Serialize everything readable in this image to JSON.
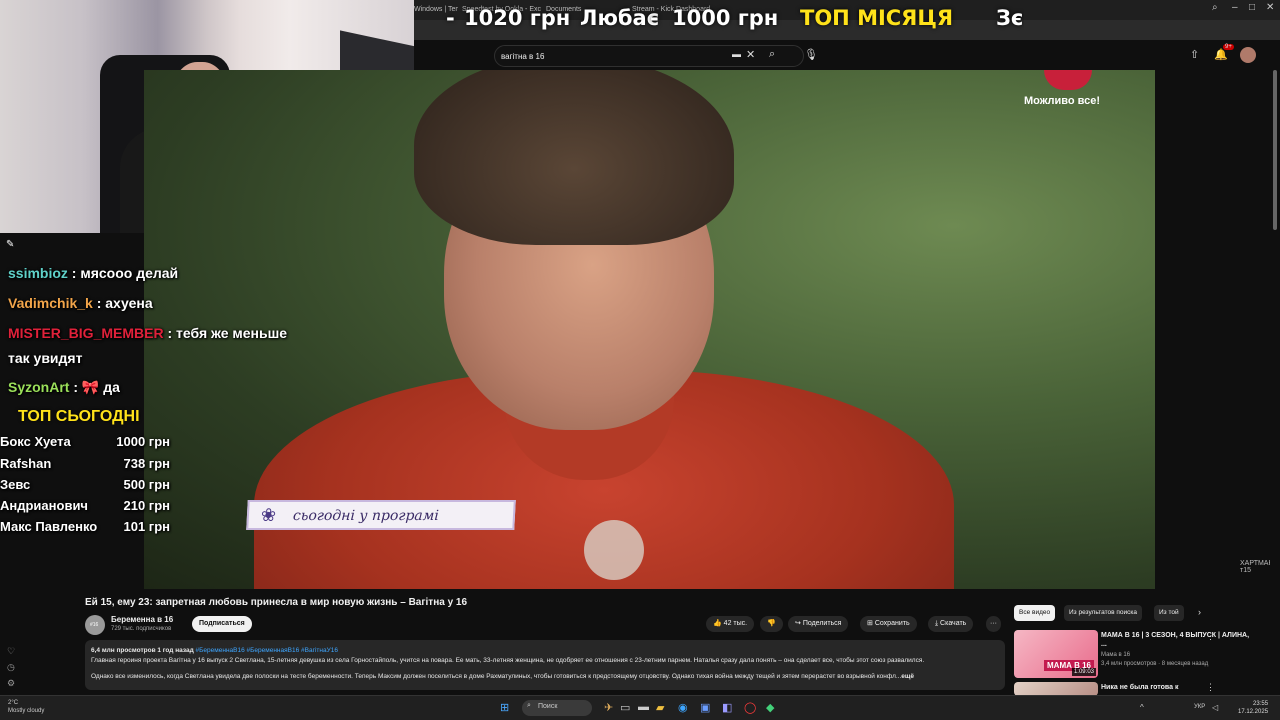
{
  "browser": {
    "tabs": [
      "Windows | Tem",
      "Speedtest by Ookla - Exc",
      "Documents",
      "Stream - Kick Dashboard"
    ],
    "window_controls": [
      "–",
      "□",
      "✕"
    ]
  },
  "ticker": {
    "items": [
      "-",
      "1020 грн",
      "Любас",
      "-",
      "1000 грн",
      "ТОП МІСЯЦЯ",
      "Зє"
    ]
  },
  "youtube": {
    "search_value": "вагітна в 16",
    "notifications_badge": "9+",
    "video": {
      "brand_text": "Можливо все!",
      "lower_third": "сьогодні у програмі",
      "watermark": "ХАРТМАН\nт15"
    },
    "title": "Ей 15, ему 23: запретная любовь принесла в мир новую жизнь – Вагітна у 16",
    "channel": {
      "name": "Беременна в 16",
      "subs": "729 тыс. подписчиков",
      "avatar": "#16"
    },
    "subscribe_label": "Подписаться",
    "actions": {
      "likes": "42 тыс.",
      "share": "Поделиться",
      "save": "Сохранить",
      "download": "Скачать",
      "more": "···"
    },
    "description": {
      "meta": "6,4 млн просмотров  1 год назад",
      "tags": "#БеременнаВ16 #БеременнаяВ16 #ВагітнаУ16",
      "line1": "Главная героиня проекта Вагітна у 16 выпуск 2 Светлана, 15-летняя девушка из села Горностайполь, учится на повара. Ее мать, 33-летняя женщина, не одобряет ее отношения с 23-летним парнем. Наталья сразу дала понять – она сделает все, чтобы этот союз развалился.",
      "line2": "Однако все изменилось, когда Светлана увидела две полоски на тесте беременности. Теперь Максим должен поселиться в доме Рахматулиных, чтобы готовиться к предстоящему отцовству. Однако тихая война между тещей и зятем перерастет во взрывной конфл...",
      "more": "ещё"
    },
    "chips": [
      "Все видео",
      "Из результатов поиска",
      "Из той"
    ],
    "recommendations": [
      {
        "title": "МАМА В 16 | 3 СЕЗОН, 4 ВЫПУСК | АЛИНА, ...",
        "channel": "Мама в 16",
        "meta": "3,4 млн просмотров · 8 месяцев назад",
        "duration": "1:09:03",
        "thumb_text": "МАМА В 16"
      },
      {
        "title": "Ника не была готова к",
        "channel": "",
        "meta": "",
        "duration": "",
        "thumb_text": ""
      }
    ]
  },
  "chat": {
    "messages": [
      {
        "nick": "ssimbioz",
        "color": "#5fd1c9",
        "text": " : мясооо делай"
      },
      {
        "nick": "Vadimchik_k",
        "color": "#f2a54a",
        "text": " : ахуена"
      },
      {
        "nick": "MISTER_BIG_MEMBER",
        "color": "#e0213a",
        "text": " : тебя же меньше"
      },
      {
        "nick": "",
        "color": "#ffffff",
        "text": "так увидят"
      },
      {
        "nick": "SyzonArt",
        "color": "#9be05a",
        "text": " :  🎀  да"
      }
    ],
    "top_title": "ТОП СЬОГОДНІ",
    "top_list": [
      {
        "name": "Бокс Хуета",
        "amount": "1000 грн"
      },
      {
        "name": "Rafshan",
        "amount": "738 грн"
      },
      {
        "name": "Зевс",
        "amount": "500 грн"
      },
      {
        "name": "Андрианович",
        "amount": "210 грн"
      },
      {
        "name": "Макс Павленко",
        "amount": "101 грн"
      }
    ]
  },
  "taskbar": {
    "search_label": "Поиск",
    "weather_temp": "2°C",
    "weather_desc": "Mostly cloudy",
    "time": "23:55",
    "date": "17.12.2025",
    "lang": "УКР"
  }
}
